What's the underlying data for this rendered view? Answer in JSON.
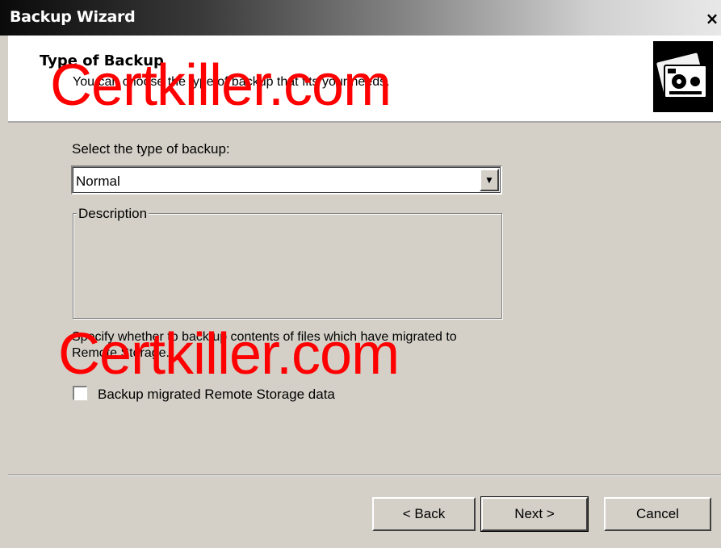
{
  "window": {
    "title": "Backup Wizard",
    "close_label": "×"
  },
  "header": {
    "title": "Type of Backup",
    "subtitle": "You can choose the type of backup that fits your needs."
  },
  "main": {
    "select_label": "Select the type of backup:",
    "backup_type_value": "Normal",
    "description_legend": "Description",
    "specify_text": "Specify whether to back up contents of files which have migrated to Remote Storage.",
    "checkbox_label": "Backup migrated Remote Storage data",
    "checkbox_checked": false
  },
  "buttons": {
    "back": "< Back",
    "next": "Next >",
    "cancel": "Cancel"
  },
  "watermark": [
    "Certkiller.com",
    "Certkiller.com"
  ],
  "icons": {
    "header": "backup-tapes-icon",
    "dropdown": "chevron-down-icon"
  }
}
